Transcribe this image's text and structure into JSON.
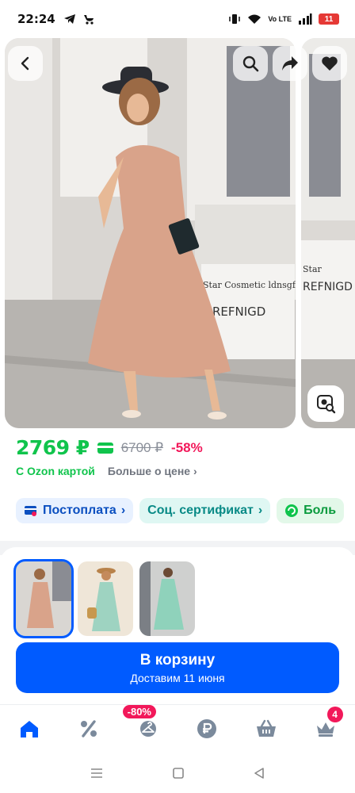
{
  "status_bar": {
    "time": "22:24",
    "network": "Vo LTE",
    "battery": "11"
  },
  "product": {
    "price": "2769 ₽",
    "old_price": "6700 ₽",
    "discount": "-58%",
    "ozon_card_label": "С Ozon картой",
    "more_price_label": "Больше о цене",
    "chips": [
      {
        "label": "Постоплата",
        "icon": "card-postpay-icon"
      },
      {
        "label": "Соц. сертификат",
        "icon": "certificate-icon"
      },
      {
        "label": "Боль",
        "icon": "green-circle-icon"
      }
    ],
    "photo_text": {
      "sign_line1": "Star Cosmetic ldnsgf One",
      "sign_line2": "REFNIGD",
      "next_sign_line1": "Star",
      "next_sign_line2": "REFNIGD"
    },
    "thumbnails": [
      {
        "name": "thumb-pink-dress",
        "selected": true
      },
      {
        "name": "thumb-mint-dress-with-bag",
        "selected": false
      },
      {
        "name": "thumb-mint-dress-street",
        "selected": false
      }
    ]
  },
  "cart": {
    "title": "В корзину",
    "subtitle": "Доставим 11 июня"
  },
  "bottom_nav": {
    "items": [
      "home-icon",
      "percent-icon",
      "hanger-icon",
      "ruble-icon",
      "basket-icon",
      "crown-icon"
    ],
    "sale_badge": "-80%",
    "crown_badge": "4",
    "active_color": "#005bff",
    "inactive_color": "#7b8a9c"
  },
  "colors": {
    "accent": "#005bff",
    "price_green": "#10c44c",
    "discount_pink": "#f2185a"
  }
}
